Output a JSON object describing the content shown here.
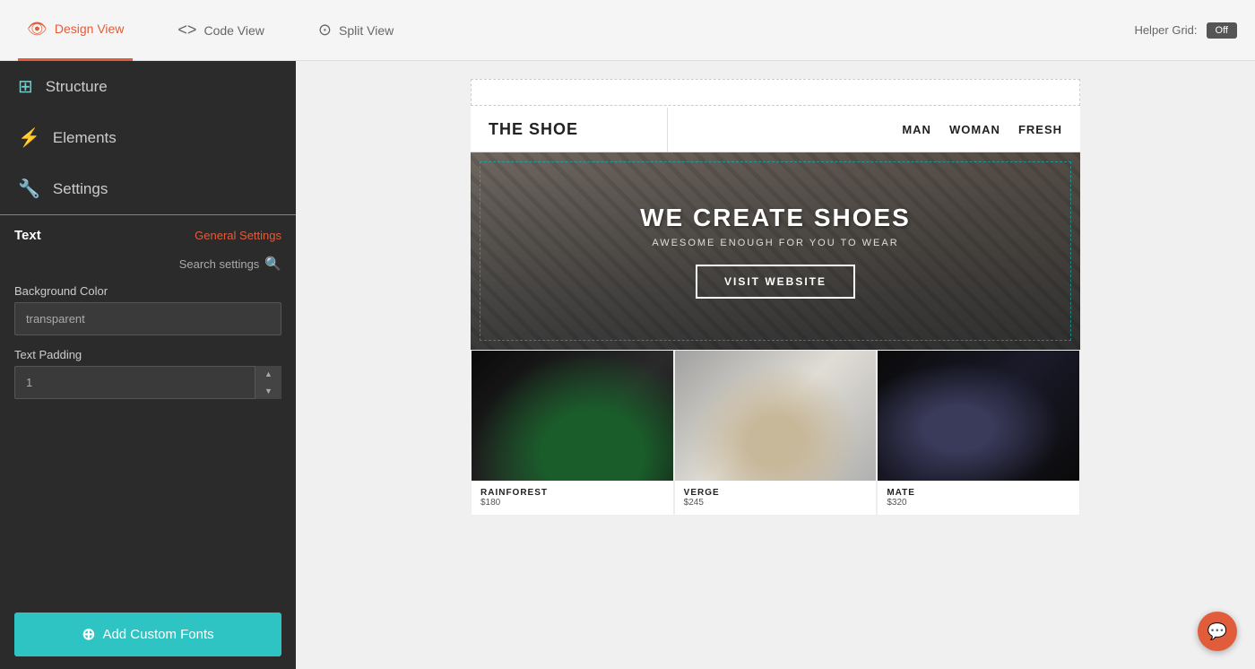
{
  "topbar": {
    "tabs": [
      {
        "id": "design",
        "label": "Design View",
        "active": true
      },
      {
        "id": "code",
        "label": "Code View",
        "active": false
      },
      {
        "id": "split",
        "label": "Split View",
        "active": false
      }
    ],
    "helper_grid_label": "Helper Grid:",
    "helper_grid_value": "Off"
  },
  "sidebar": {
    "nav": [
      {
        "id": "structure",
        "label": "Structure",
        "icon": "⊞"
      },
      {
        "id": "elements",
        "label": "Elements",
        "icon": "⚡"
      },
      {
        "id": "settings",
        "label": "Settings",
        "icon": "🔧"
      }
    ],
    "panel": {
      "title": "Text",
      "general_settings_link": "General Settings",
      "search_settings_label": "Search settings",
      "background_color_label": "Background Color",
      "background_color_value": "transparent",
      "text_padding_label": "Text Padding",
      "text_padding_value": "1",
      "add_fonts_label": "Add Custom Fonts"
    }
  },
  "preview": {
    "site": {
      "logo": "THE SHOE",
      "nav_items": [
        "MAN",
        "WOMAN",
        "FRESH"
      ],
      "hero": {
        "title": "WE CREATE SHOES",
        "subtitle": "AWESOME ENOUGH FOR YOU TO WEAR",
        "cta_label": "VISIT WEBSITE"
      },
      "products": [
        {
          "id": "rainforest",
          "name": "RAINFOREST",
          "price": "$180"
        },
        {
          "id": "verge",
          "name": "VERGE",
          "price": "$245"
        },
        {
          "id": "mate",
          "name": "MATE",
          "price": "$320"
        }
      ]
    }
  }
}
